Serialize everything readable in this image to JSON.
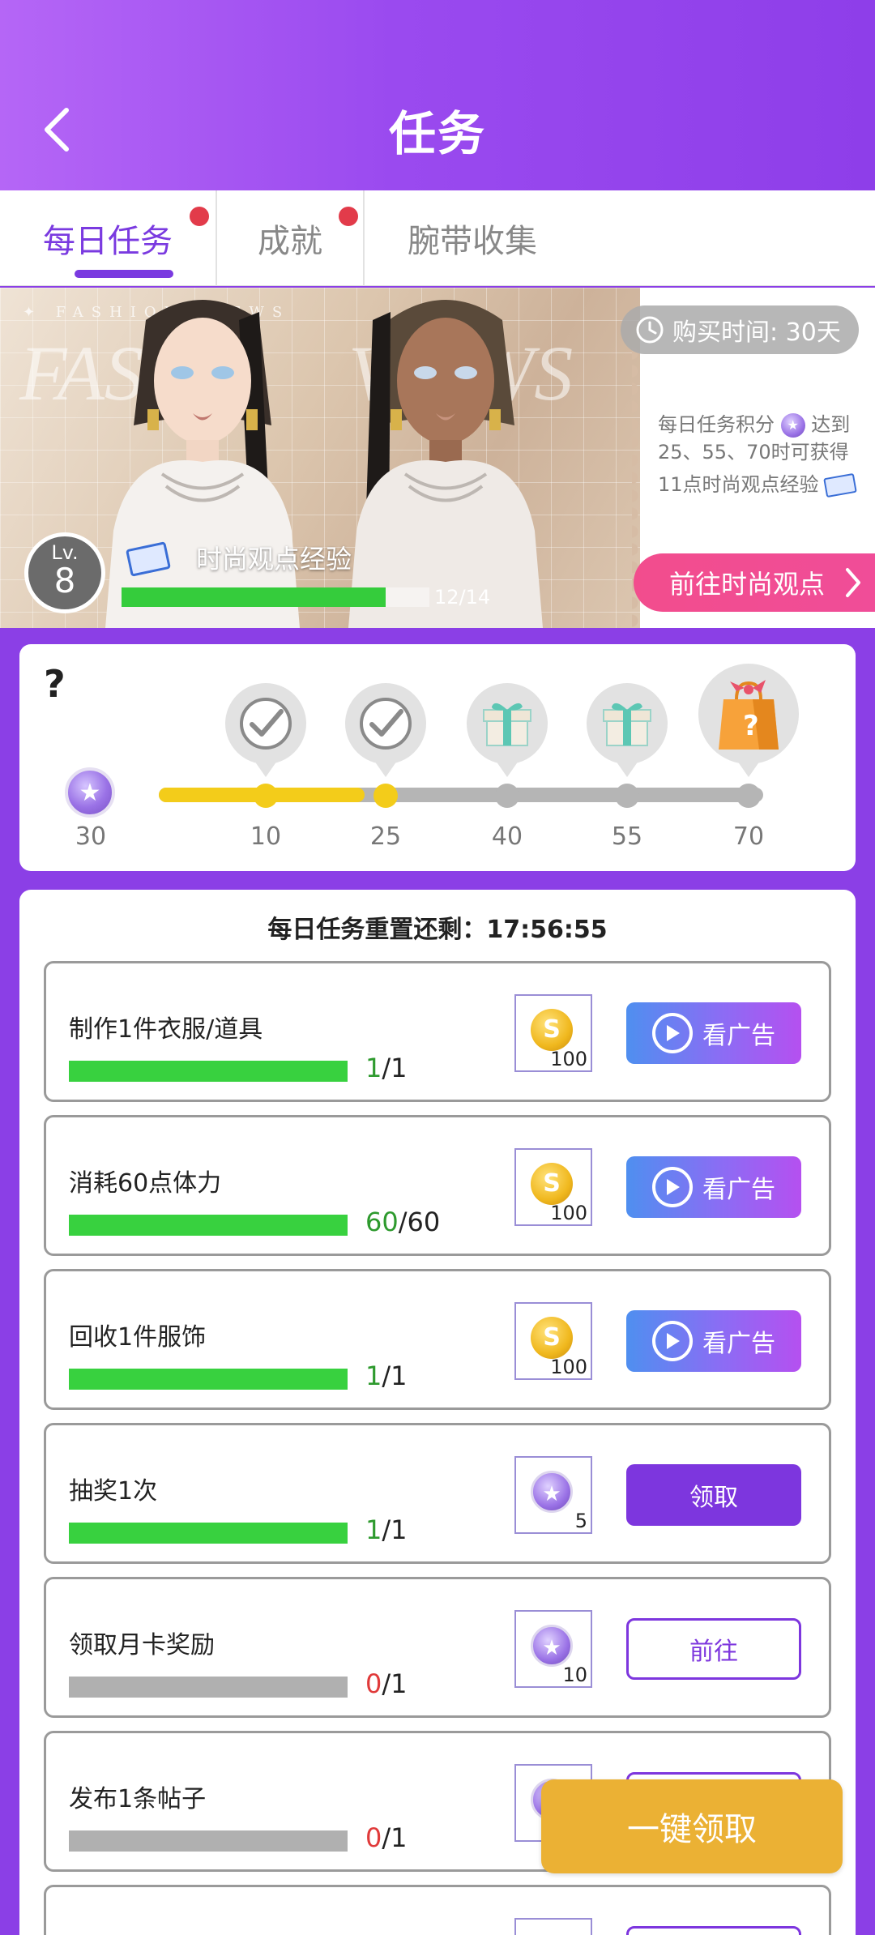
{
  "header": {
    "title": "任务"
  },
  "tabs": [
    {
      "label": "每日任务",
      "has_dot": true,
      "active": true
    },
    {
      "label": "成就",
      "has_dot": true,
      "active": false
    },
    {
      "label": "腕带收集",
      "has_dot": false,
      "active": false
    }
  ],
  "banner": {
    "watermark_top": "✦ FASHION          VIEWS",
    "watermark_word_left": "FASH",
    "watermark_word_right": "VIEWS",
    "buy_time": "购买时间: 30天",
    "desc_line1": "每日任务积分",
    "desc_line1b": "达到",
    "desc_line2": "25、55、70时可获得",
    "desc_line3": "11点时尚观点经验",
    "goto_label": "前往时尚观点",
    "level_prefix": "Lv.",
    "level": "8",
    "exp_title": "时尚观点经验",
    "exp_count": "12/14",
    "exp_progress": 0.857
  },
  "points": {
    "current": "30",
    "progress": 0.34,
    "milestones": [
      {
        "value": "10",
        "state": "claimed"
      },
      {
        "value": "25",
        "state": "claimed"
      },
      {
        "value": "40",
        "state": "gift"
      },
      {
        "value": "55",
        "state": "gift"
      },
      {
        "value": "70",
        "state": "mystery-bag"
      }
    ]
  },
  "tasks": {
    "reset_text": "每日任务重置还剩：17:56:55",
    "items": [
      {
        "name": "制作1件衣服/道具",
        "current": "1",
        "total": "/1",
        "progress": 1.0,
        "done": true,
        "reward_type": "gold-coin",
        "reward_qty": "100",
        "action": "ad",
        "action_label": "看广告"
      },
      {
        "name": "消耗60点体力",
        "current": "60",
        "total": "/60",
        "progress": 1.0,
        "done": true,
        "reward_type": "gold-coin",
        "reward_qty": "100",
        "action": "ad",
        "action_label": "看广告"
      },
      {
        "name": "回收1件服饰",
        "current": "1",
        "total": "/1",
        "progress": 1.0,
        "done": true,
        "reward_type": "gold-coin",
        "reward_qty": "100",
        "action": "ad",
        "action_label": "看广告"
      },
      {
        "name": "抽奖1次",
        "current": "1",
        "total": "/1",
        "progress": 1.0,
        "done": true,
        "reward_type": "star-coin",
        "reward_qty": "5",
        "action": "claim",
        "action_label": "领取"
      },
      {
        "name": "领取月卡奖励",
        "current": "0",
        "total": "/1",
        "progress": 0.0,
        "done": false,
        "reward_type": "star-coin",
        "reward_qty": "10",
        "action": "go",
        "action_label": "前往"
      },
      {
        "name": "发布1条帖子",
        "current": "0",
        "total": "/1",
        "progress": 0.0,
        "done": false,
        "reward_type": "star-coin",
        "reward_qty": "",
        "action": "go",
        "action_label": ""
      }
    ]
  },
  "claim_all_label": "一键领取",
  "colors": {
    "accent": "#7d36de",
    "header_start": "#b566f6",
    "progress_green": "#38d13f",
    "points_yellow": "#f3cc1a",
    "claim_all": "#ebb134"
  }
}
